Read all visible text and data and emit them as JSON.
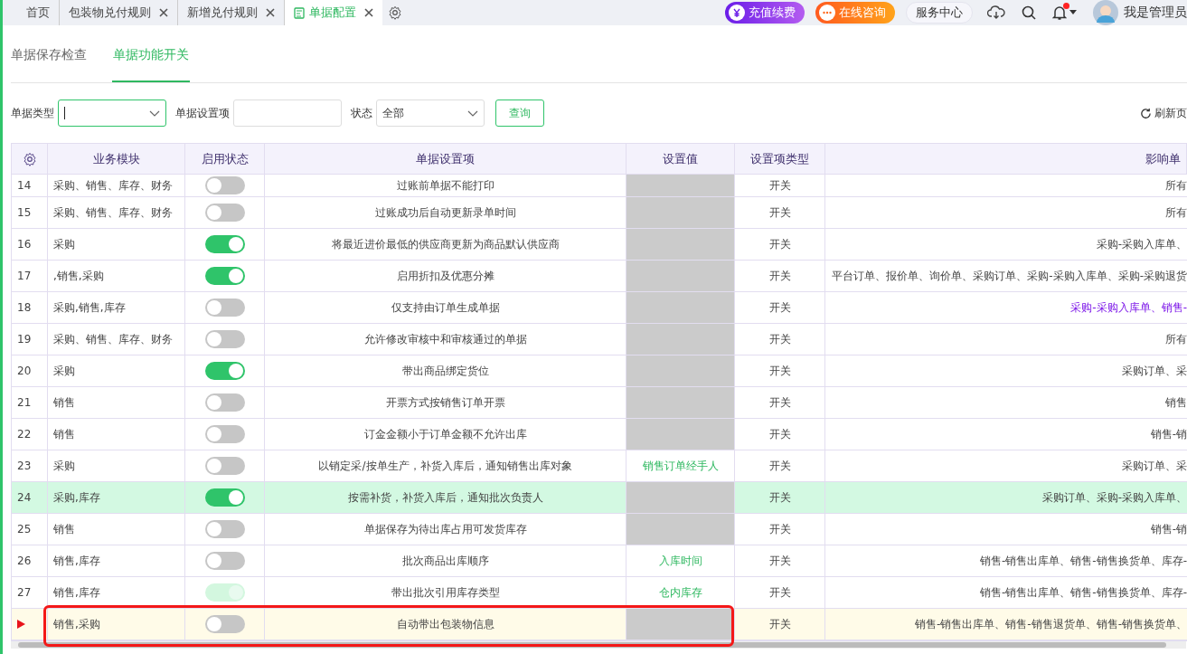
{
  "tabs": [
    {
      "label": "首页",
      "selected": false,
      "closable": false,
      "icon": false
    },
    {
      "label": "包装物兑付规则",
      "selected": false,
      "closable": true,
      "icon": false
    },
    {
      "label": "新增兑付规则",
      "selected": false,
      "closable": true,
      "icon": false
    },
    {
      "label": "单据配置",
      "selected": true,
      "closable": true,
      "icon": true
    }
  ],
  "header": {
    "recharge": "充值续费",
    "consult": "在线咨询",
    "service": "服务中心",
    "user": "我是管理员",
    "notification_dot": true
  },
  "subtabs": [
    {
      "label": "单据保存检查",
      "selected": false
    },
    {
      "label": "单据功能开关",
      "selected": true
    }
  ],
  "filters": {
    "doc_type_label": "单据类型",
    "item_label": "单据设置项",
    "status_label": "状态",
    "status_value": "全部",
    "query": "查询",
    "refresh": "刷新页"
  },
  "table": {
    "columns": [
      "业务模块",
      "启用状态",
      "单据设置项",
      "设置值",
      "设置项类型",
      "影响单"
    ],
    "rows": [
      {
        "no": "14",
        "module": "采购、销售、库存、财务",
        "on": false,
        "disabled": false,
        "item": "过账前单据不能打印",
        "value": "",
        "type": "开关",
        "affects": "所有",
        "emphasis": false,
        "selected": false,
        "current": false
      },
      {
        "no": "15",
        "module": "采购、销售、库存、财务",
        "on": false,
        "disabled": false,
        "item": "过账成功后自动更新录单时间",
        "value": "",
        "type": "开关",
        "affects": "所有",
        "emphasis": false,
        "selected": false,
        "current": false
      },
      {
        "no": "16",
        "module": "采购",
        "on": true,
        "disabled": false,
        "item": "将最近进价最低的供应商更新为商品默认供应商",
        "value": "",
        "type": "开关",
        "affects": "采购-采购入库单、",
        "emphasis": false,
        "selected": false,
        "current": false
      },
      {
        "no": "17",
        "module": ",销售,采购",
        "on": true,
        "disabled": false,
        "item": "启用折扣及优惠分摊",
        "value": "",
        "type": "开关",
        "affects": "平台订单、报价单、询价单、采购订单、采购-采购入库单、采购-采购退货",
        "emphasis": false,
        "selected": false,
        "current": false
      },
      {
        "no": "18",
        "module": "采购,销售,库存",
        "on": false,
        "disabled": false,
        "item": "仅支持由订单生成单据",
        "value": "",
        "type": "开关",
        "affects": "采购-采购入库单、销售-",
        "emphasis": true,
        "selected": false,
        "current": false
      },
      {
        "no": "19",
        "module": "采购、销售、库存、财务",
        "on": false,
        "disabled": false,
        "item": "允许修改审核中和审核通过的单据",
        "value": "",
        "type": "开关",
        "affects": "所有",
        "emphasis": false,
        "selected": false,
        "current": false
      },
      {
        "no": "20",
        "module": "采购",
        "on": true,
        "disabled": false,
        "item": "带出商品绑定货位",
        "value": "",
        "type": "开关",
        "affects": "采购订单、采",
        "emphasis": false,
        "selected": false,
        "current": false
      },
      {
        "no": "21",
        "module": "销售",
        "on": false,
        "disabled": false,
        "item": "开票方式按销售订单开票",
        "value": "",
        "type": "开关",
        "affects": "销售",
        "emphasis": false,
        "selected": false,
        "current": false
      },
      {
        "no": "22",
        "module": "销售",
        "on": false,
        "disabled": false,
        "item": "订金金额小于订单金额不允许出库",
        "value": "",
        "type": "开关",
        "affects": "销售-销",
        "emphasis": false,
        "selected": false,
        "current": false
      },
      {
        "no": "23",
        "module": "采购",
        "on": false,
        "disabled": false,
        "item": "以销定采/按单生产，补货入库后，通知销售出库对象",
        "value": "销售订单经手人",
        "type": "开关",
        "affects": "采购订单、采",
        "emphasis": false,
        "selected": false,
        "current": false
      },
      {
        "no": "24",
        "module": "采购,库存",
        "on": true,
        "disabled": false,
        "item": "按需补货，补货入库后，通知批次负责人",
        "value": "",
        "type": "开关",
        "affects": "采购订单、采购-采购入库单、",
        "emphasis": false,
        "selected": true,
        "current": false
      },
      {
        "no": "25",
        "module": "销售",
        "on": false,
        "disabled": false,
        "item": "单据保存为待出库占用可发货库存",
        "value": "",
        "type": "开关",
        "affects": "销售-销",
        "emphasis": false,
        "selected": false,
        "current": false
      },
      {
        "no": "26",
        "module": "销售,库存",
        "on": false,
        "disabled": false,
        "item": "批次商品出库顺序",
        "value": "入库时间",
        "type": "开关",
        "affects": "销售-销售出库单、销售-销售换货单、库存-",
        "emphasis": false,
        "selected": false,
        "current": false
      },
      {
        "no": "27",
        "module": "销售,库存",
        "on": true,
        "disabled": true,
        "item": "带出批次引用库存类型",
        "value": "仓内库存",
        "type": "开关",
        "affects": "销售-销售出库单、销售-销售换货单、库存-",
        "emphasis": false,
        "selected": false,
        "current": false
      },
      {
        "no": "",
        "module": "销售,采购",
        "on": false,
        "disabled": false,
        "item": "自动带出包装物信息",
        "value": "",
        "type": "开关",
        "affects": "销售-销售出库单、销售-销售退货单、销售-销售换货单、",
        "emphasis": false,
        "selected": false,
        "current": true
      }
    ]
  }
}
